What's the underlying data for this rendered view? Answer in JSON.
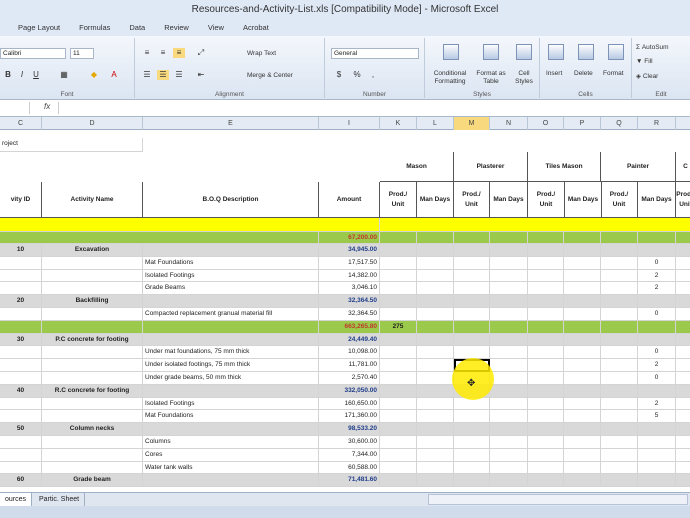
{
  "title": "Resources-and-Activity-List.xls  [Compatibility Mode]  -  Microsoft Excel",
  "menu": [
    "Page Layout",
    "Formulas",
    "Data",
    "Review",
    "View",
    "Acrobat"
  ],
  "ribbon": {
    "font_name": "Calibri",
    "font_size": "11",
    "wrap_text": "Wrap Text",
    "merge_center": "Merge & Center",
    "number_format": "General",
    "conditional_formatting": "Conditional Formatting",
    "format_as_table": "Format as Table",
    "cell_styles": "Cell Styles",
    "insert": "Insert",
    "delete": "Delete",
    "format": "Format",
    "autosum": "AutoSum",
    "fill": "Fill",
    "clear": "Clear",
    "groups": [
      "Font",
      "Alignment",
      "Number",
      "Styles",
      "Cells",
      "Edit"
    ]
  },
  "formula": {
    "fx": "fx",
    "value": ""
  },
  "columns": [
    "C",
    "D",
    "E",
    "I",
    "K",
    "L",
    "M",
    "N",
    "O",
    "P",
    "Q",
    "R"
  ],
  "sheet": {
    "project_label": "roject",
    "headers": {
      "activity_id": "vity ID",
      "activity_name": "Activity Name",
      "boq": "B.O.Q Description",
      "amount": "Amount"
    },
    "groups": [
      "Mason",
      "Plasterer",
      "Tiles Mason",
      "Painter",
      "C"
    ],
    "sub": [
      "Prod./ Unit",
      "Man Days"
    ],
    "total": "67,200.00",
    "rows": [
      {
        "id": "10",
        "name": "Excavation",
        "desc": "",
        "amt": "34,945.00",
        "style": "activity"
      },
      {
        "id": "",
        "name": "",
        "desc": "Mat Foundations",
        "amt": "17,517.50",
        "style": "item"
      },
      {
        "id": "",
        "name": "",
        "desc": "Isolated Footings",
        "amt": "14,382.00",
        "style": "item"
      },
      {
        "id": "",
        "name": "",
        "desc": "Grade Beams",
        "amt": "3,046.10",
        "style": "item"
      },
      {
        "id": "20",
        "name": "Backfilling",
        "desc": "",
        "amt": "32,364.50",
        "style": "activity"
      },
      {
        "id": "",
        "name": "",
        "desc": "Compacted replacement granual material fill",
        "amt": "32,364.50",
        "style": "item"
      },
      {
        "id": "",
        "name": "",
        "desc": "",
        "amt": "663,265.80",
        "style": "green",
        "mason": "275"
      },
      {
        "id": "30",
        "name": "P.C concrete for footing",
        "desc": "",
        "amt": "24,449.40",
        "style": "activity"
      },
      {
        "id": "",
        "name": "",
        "desc": "Under mat foundations, 75 mm thick",
        "amt": "10,098.00",
        "style": "item"
      },
      {
        "id": "",
        "name": "",
        "desc": "Under isolated footings, 75 mm thick",
        "amt": "11,781.00",
        "style": "item"
      },
      {
        "id": "",
        "name": "",
        "desc": "Under grade beams, 50 mm thick",
        "amt": "2,570.40",
        "style": "item"
      },
      {
        "id": "40",
        "name": "R.C concrete for footing",
        "desc": "",
        "amt": "332,050.00",
        "style": "activity"
      },
      {
        "id": "",
        "name": "",
        "desc": "Isolated Footings",
        "amt": "160,650.00",
        "style": "item"
      },
      {
        "id": "",
        "name": "",
        "desc": "Mat Foundations",
        "amt": "171,360.00",
        "style": "item"
      },
      {
        "id": "50",
        "name": "Column necks",
        "desc": "",
        "amt": "98,533.20",
        "style": "activity"
      },
      {
        "id": "",
        "name": "",
        "desc": "Columns",
        "amt": "30,600.00",
        "style": "item"
      },
      {
        "id": "",
        "name": "",
        "desc": "Cores",
        "amt": "7,344.00",
        "style": "item"
      },
      {
        "id": "",
        "name": "",
        "desc": "Water tank walls",
        "amt": "60,588.00",
        "style": "item"
      },
      {
        "id": "60",
        "name": "Grade beam",
        "desc": "",
        "amt": "71,481.60",
        "style": "activity"
      }
    ],
    "right_edge": [
      "",
      "0",
      "2",
      "2",
      "",
      "0",
      "",
      "",
      "0",
      "2",
      "0",
      "",
      "2",
      "5",
      "",
      "",
      "",
      "",
      ""
    ]
  },
  "tabs": [
    "ources",
    "Partic. Sheet"
  ]
}
